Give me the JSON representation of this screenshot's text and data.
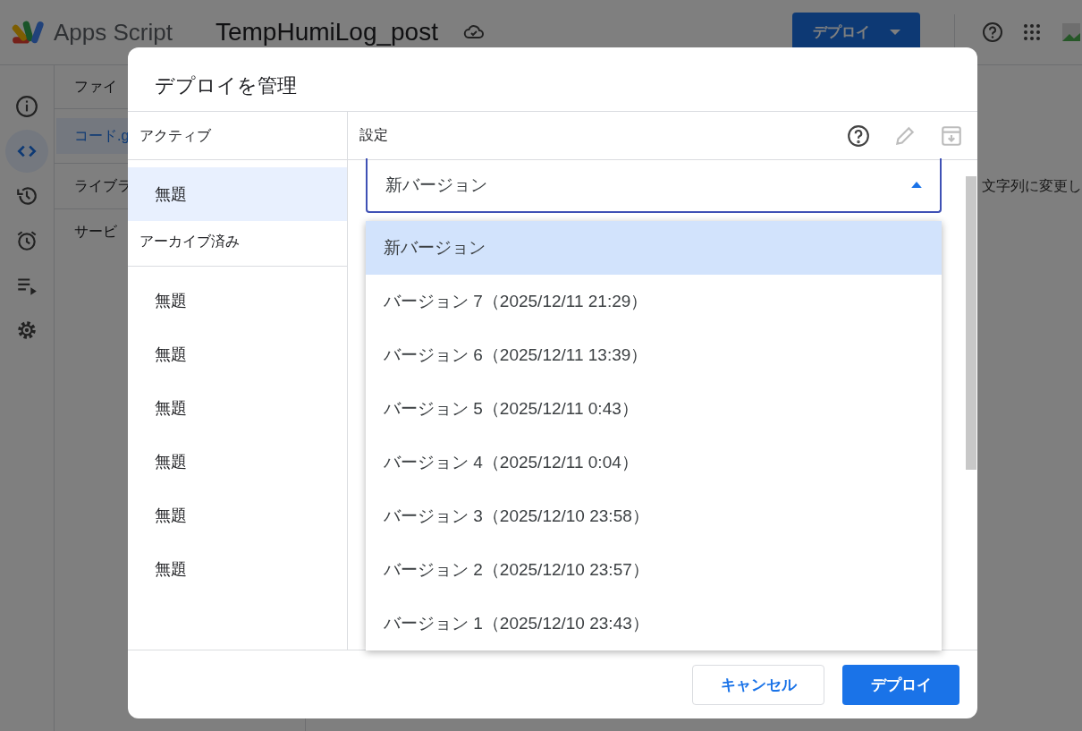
{
  "app": {
    "logo": "Apps Script",
    "project": "TempHumiLog_post",
    "deploy_button": "デプロイ",
    "rail": [
      {
        "kind": "info",
        "selected": false
      },
      {
        "kind": "code",
        "selected": true
      },
      {
        "kind": "history",
        "selected": false
      },
      {
        "kind": "alarm",
        "selected": false
      },
      {
        "kind": "executions",
        "selected": false
      },
      {
        "kind": "settings",
        "selected": false
      }
    ],
    "files_header": "ファイ",
    "files": [
      {
        "name": "コード.g",
        "selected": true
      }
    ],
    "sections": [
      "ライブラ",
      "サービ"
    ],
    "editor_fragment": "文字列に変更し"
  },
  "dialog": {
    "title": "デプロイを管理",
    "active_header": "アクティブ",
    "active": [
      {
        "label": "無題",
        "selected": true
      }
    ],
    "archived_header": "アーカイブ済み",
    "archived": [
      {
        "label": "無題",
        "selected": false
      },
      {
        "label": "無題",
        "selected": false
      },
      {
        "label": "無題",
        "selected": false
      },
      {
        "label": "無題",
        "selected": false
      },
      {
        "label": "無題",
        "selected": false
      },
      {
        "label": "無題",
        "selected": false
      }
    ],
    "settings_header": "設定",
    "actions": [
      {
        "kind": "help",
        "disabled": false
      },
      {
        "kind": "edit",
        "disabled": true
      },
      {
        "kind": "archive",
        "disabled": true
      }
    ],
    "select": {
      "value": "新バージョン",
      "expanded": true
    },
    "options": [
      {
        "label": "新バージョン",
        "selected": true
      },
      {
        "label": "バージョン 7（2025/12/11 21:29）",
        "selected": false
      },
      {
        "label": "バージョン 6（2025/12/11 13:39）",
        "selected": false
      },
      {
        "label": "バージョン 5（2025/12/11 0:43）",
        "selected": false
      },
      {
        "label": "バージョン 4（2025/12/11 0:04）",
        "selected": false
      },
      {
        "label": "バージョン 3（2025/12/10 23:58）",
        "selected": false
      },
      {
        "label": "バージョン 2（2025/12/10 23:57）",
        "selected": false
      },
      {
        "label": "バージョン 1（2025/12/10 23:43）",
        "selected": false
      }
    ],
    "buttons": [
      {
        "label": "キャンセル",
        "kind": "secondary"
      },
      {
        "label": "デプロイ",
        "kind": "primary"
      }
    ]
  }
}
